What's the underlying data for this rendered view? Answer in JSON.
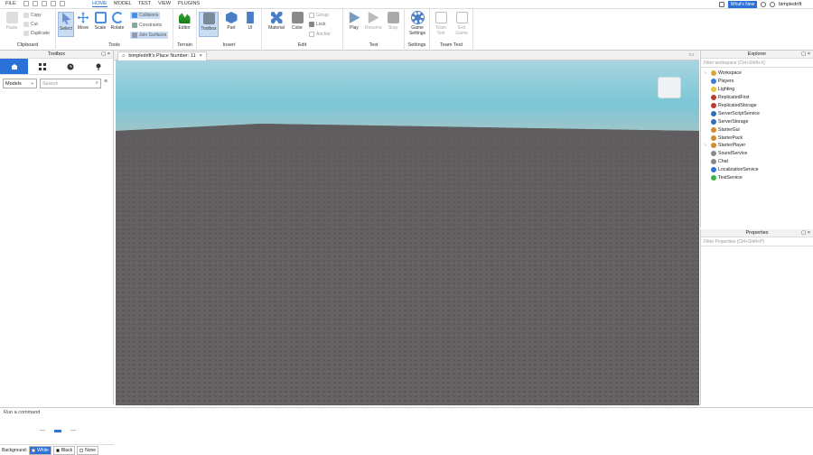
{
  "menubar": {
    "items": [
      {
        "label": "FILE"
      },
      {
        "label": "HOME",
        "active": true
      },
      {
        "label": "MODEL"
      },
      {
        "label": "TEST"
      },
      {
        "label": "VIEW"
      },
      {
        "label": "PLUGINS"
      }
    ],
    "whats_new": "What's New",
    "user": "bimpledrift"
  },
  "ribbon": {
    "clipboard": {
      "label": "Clipboard",
      "paste": "Paste",
      "copy": "Copy",
      "cut": "Cut",
      "duplicate": "Duplicate"
    },
    "tools": {
      "label": "Tools",
      "select": "Select",
      "move": "Move",
      "scale": "Scale",
      "rotate": "Rotate",
      "collisions": "Collisions",
      "constraints": "Constraints",
      "join_surfaces": "Join Surfaces"
    },
    "terrain": {
      "label": "Terrain",
      "editor": "Editor"
    },
    "insert": {
      "label": "Insert",
      "toolbox": "Toolbox",
      "part": "Part",
      "ui": "UI"
    },
    "edit": {
      "label": "Edit",
      "material": "Material",
      "color": "Color",
      "group": "Group",
      "lock": "Lock",
      "anchor": "Anchor"
    },
    "test": {
      "label": "Test",
      "play": "Play",
      "resume": "Resume",
      "stop": "Stop"
    },
    "settings": {
      "label": "Settings",
      "game_settings_1": "Game",
      "game_settings_2": "Settings"
    },
    "team_test": {
      "label": "Team Test",
      "team_test_1": "Team",
      "team_test_2": "Test",
      "exit_game_1": "Exit",
      "exit_game_2": "Game"
    }
  },
  "toolbox": {
    "title": "Toolbox",
    "category": "Models",
    "search_placeholder": "Search",
    "background_label": "Background:",
    "bg_options": [
      "White",
      "Black",
      "None"
    ]
  },
  "viewport": {
    "tab_title": "bimpledrift's Place Number: 11"
  },
  "explorer": {
    "title": "Explorer",
    "filter_placeholder": "Filter workspace (Ctrl+Shift+X)",
    "items": [
      {
        "label": "Workspace",
        "expandable": true,
        "color": "#d9a63a"
      },
      {
        "label": "Players",
        "expandable": false,
        "color": "#3a7bd5"
      },
      {
        "label": "Lighting",
        "expandable": false,
        "color": "#e8c440"
      },
      {
        "label": "ReplicatedFirst",
        "expandable": false,
        "color": "#c0392b"
      },
      {
        "label": "ReplicatedStorage",
        "expandable": false,
        "color": "#c0392b"
      },
      {
        "label": "ServerScriptService",
        "expandable": false,
        "color": "#2d6fb8"
      },
      {
        "label": "ServerStorage",
        "expandable": false,
        "color": "#2d6fb8"
      },
      {
        "label": "StarterGui",
        "expandable": false,
        "color": "#d08c2e"
      },
      {
        "label": "StarterPack",
        "expandable": false,
        "color": "#d08c2e"
      },
      {
        "label": "StarterPlayer",
        "expandable": true,
        "color": "#d08c2e"
      },
      {
        "label": "SoundService",
        "expandable": false,
        "color": "#888888"
      },
      {
        "label": "Chat",
        "expandable": false,
        "color": "#888888"
      },
      {
        "label": "LocalizationService",
        "expandable": false,
        "color": "#2a72d8"
      },
      {
        "label": "TestService",
        "expandable": false,
        "color": "#3bb54a"
      }
    ]
  },
  "properties": {
    "title": "Properties",
    "filter_placeholder": "Filter Properties (Ctrl+Shift+P)"
  },
  "command_bar": {
    "placeholder": "Run a command"
  },
  "colors": {
    "accent": "#2a72d8",
    "sky": "#7cc6d6",
    "baseplate": "#646163"
  }
}
